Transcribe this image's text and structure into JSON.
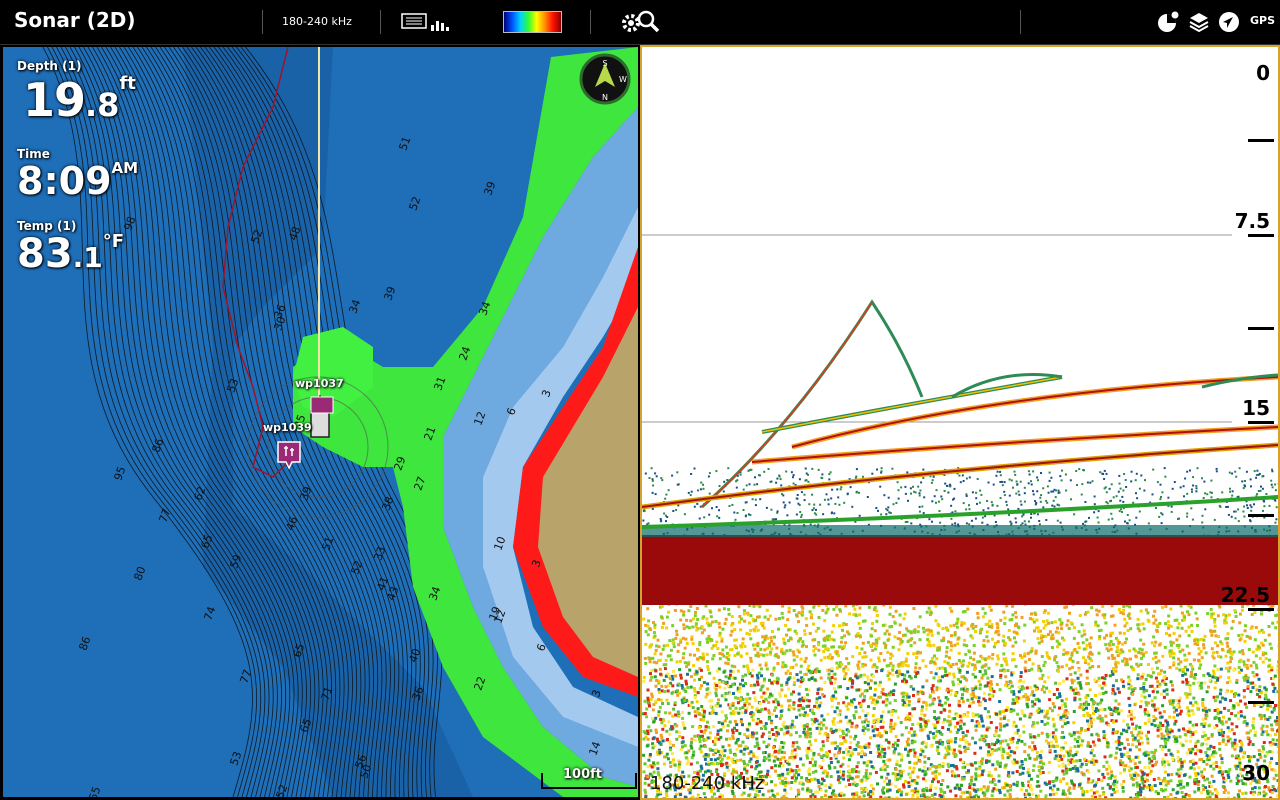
{
  "topbar": {
    "title": "Sonar (2D)",
    "frequency": "180-240 kHz",
    "gps_label": "GPS",
    "icons": [
      "chart-grid-icon",
      "signal-bars-icon",
      "color-palette",
      "settings-gear-icon",
      "search-zoom-icon",
      "map-pie-icon",
      "layers-icon",
      "navigation-arrow-icon",
      "gps-icon"
    ]
  },
  "chart": {
    "depth_label": "Depth (1)",
    "depth_whole": "19",
    "depth_decimal": ".8",
    "depth_unit": "ft",
    "time_label": "Time",
    "time_value": "8:09",
    "time_suffix": "AM",
    "temp_label": "Temp (1)",
    "temp_whole": "83",
    "temp_decimal": ".1",
    "temp_unit": "°F",
    "scale_label": "100ft",
    "waypoint_labels": [
      "wp1037",
      "wp1039"
    ],
    "contour_labels": [
      "98",
      "52",
      "48",
      "34",
      "39",
      "36",
      "53",
      "86",
      "95",
      "77",
      "62",
      "65",
      "59",
      "46",
      "51",
      "52",
      "80",
      "86",
      "74",
      "65",
      "77",
      "65",
      "71",
      "53",
      "56",
      "52",
      "50",
      "39",
      "30",
      "41",
      "43",
      "34",
      "38",
      "40",
      "36",
      "33",
      "29",
      "27",
      "22",
      "19",
      "21",
      "24",
      "31",
      "34",
      "51",
      "52",
      "39",
      "3",
      "6",
      "12",
      "10",
      "12",
      "14",
      "6",
      "3",
      "3",
      "25",
      "55"
    ]
  },
  "sonar": {
    "depth_scale": [
      "0",
      "7.5",
      "15",
      "22.5",
      "30"
    ],
    "frequency_overlay": "180-240 kHz"
  }
}
